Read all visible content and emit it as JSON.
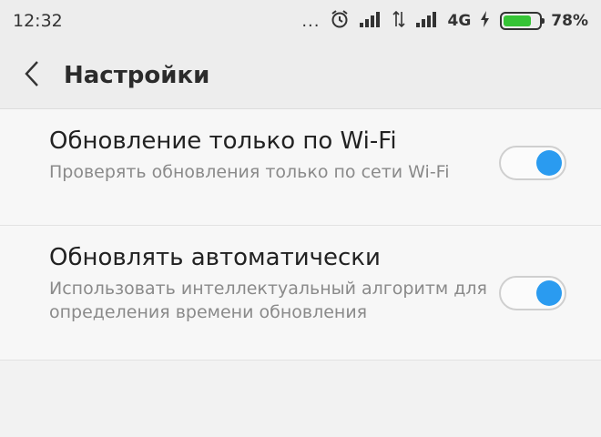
{
  "status_bar": {
    "time": "12:32",
    "dots": "...",
    "network": "4G",
    "battery_percent": "78%",
    "battery_level": 0.78,
    "battery_color": "#36c436"
  },
  "header": {
    "title": "Настройки",
    "back_icon": "chevron-left-icon"
  },
  "settings": [
    {
      "title": "Обновление только по Wi-Fi",
      "description": "Проверять обновления только по сети Wi-Fi",
      "enabled": true
    },
    {
      "title": "Обновлять автоматически",
      "description": "Использовать интеллектуальный алгоритм для определения времени обновления",
      "enabled": true
    }
  ],
  "colors": {
    "toggle_on": "#2a9bf0",
    "background": "#f2f2f2"
  }
}
